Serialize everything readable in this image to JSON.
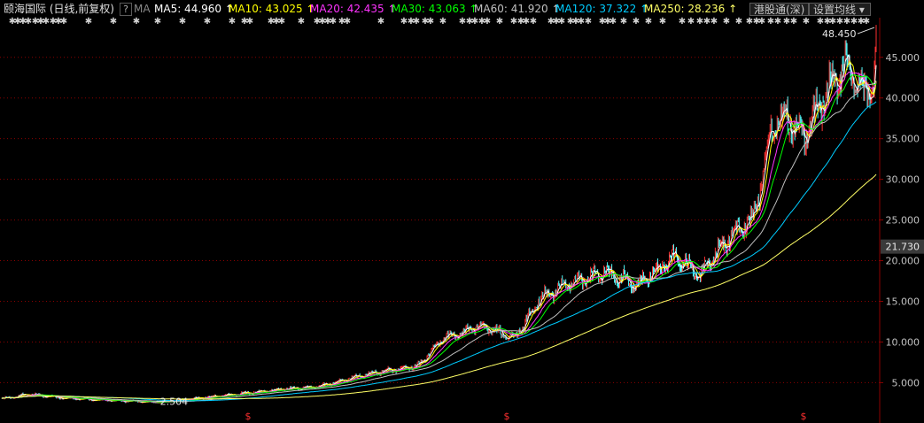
{
  "header": {
    "stock_title": "颐海国际 (日线,前复权)",
    "help_icon": "?",
    "indicator_name": "MA",
    "ma_items": [
      {
        "label": "MA5: 44.960",
        "arrow": "↑",
        "color": "#ffffff"
      },
      {
        "label": "MA10: 43.025",
        "arrow": "↑",
        "color": "#ffff00"
      },
      {
        "label": "MA20: 42.435",
        "arrow": "↑",
        "color": "#ff33ff"
      },
      {
        "label": "MA30: 43.063",
        "arrow": "↑",
        "color": "#00ff00"
      },
      {
        "label": "MA60: 41.920",
        "arrow": "↑",
        "color": "#c0c0c0"
      },
      {
        "label": "MA120: 37.322",
        "arrow": "↑",
        "color": "#00ccff"
      },
      {
        "label": "MA250: 28.236",
        "arrow": "↑",
        "color": "#ffff66"
      }
    ],
    "connect_button": "港股通(深)",
    "settings_button": "设置均线",
    "dropdown_icon": "▾"
  },
  "colors": {
    "up": "#ff3232",
    "down": "#54fcfc",
    "grid": "#8b0000",
    "axis_text": "#c0c0c0",
    "current_price_box": "#3a3a3a"
  },
  "chart_data": {
    "type": "line",
    "title": "",
    "xlabel": "",
    "ylabel": "",
    "ylim": [
      2.0,
      49.0
    ],
    "y_ticks": [
      5.0,
      10.0,
      15.0,
      20.0,
      25.0,
      30.0,
      35.0,
      40.0,
      45.0
    ],
    "y_tick_labels": [
      "5.000",
      "10.000",
      "15.000",
      "20.000",
      "25.000",
      "30.000",
      "35.000",
      "40.000",
      "45.000"
    ],
    "current_price_label": "21.730",
    "current_price": 21.73,
    "high_label": "48.450",
    "high": 48.45,
    "low_label": "2.504",
    "low": 2.504,
    "event_marker_symbol": "$",
    "n_bars": 990,
    "close_anchors": [
      [
        0,
        3.0
      ],
      [
        30,
        3.6
      ],
      [
        70,
        3.1
      ],
      [
        150,
        2.7
      ],
      [
        175,
        2.55
      ],
      [
        240,
        3.3
      ],
      [
        300,
        4.0
      ],
      [
        360,
        4.6
      ],
      [
        420,
        6.2
      ],
      [
        470,
        7.0
      ],
      [
        500,
        10.5
      ],
      [
        540,
        12.0
      ],
      [
        580,
        10.5
      ],
      [
        610,
        15.5
      ],
      [
        650,
        17.5
      ],
      [
        680,
        18.5
      ],
      [
        720,
        17.0
      ],
      [
        760,
        20.5
      ],
      [
        790,
        18.2
      ],
      [
        820,
        22.5
      ],
      [
        850,
        25.0
      ],
      [
        860,
        30.0
      ],
      [
        870,
        36.0
      ],
      [
        885,
        38.0
      ],
      [
        905,
        35.0
      ],
      [
        930,
        40.0
      ],
      [
        955,
        44.5
      ],
      [
        975,
        40.5
      ],
      [
        984,
        41.0
      ],
      [
        990,
        48.4
      ]
    ],
    "series": [
      {
        "name": "MA5",
        "color": "#ffffff",
        "window": 5
      },
      {
        "name": "MA10",
        "color": "#ffff00",
        "window": 10
      },
      {
        "name": "MA20",
        "color": "#ff33ff",
        "window": 20
      },
      {
        "name": "MA30",
        "color": "#00ff00",
        "window": 30
      },
      {
        "name": "MA60",
        "color": "#c0c0c0",
        "window": 60
      },
      {
        "name": "MA120",
        "color": "#00ccff",
        "window": 120
      },
      {
        "name": "MA250",
        "color": "#ffff66",
        "window": 250
      }
    ],
    "grid": true,
    "legend": "top"
  }
}
